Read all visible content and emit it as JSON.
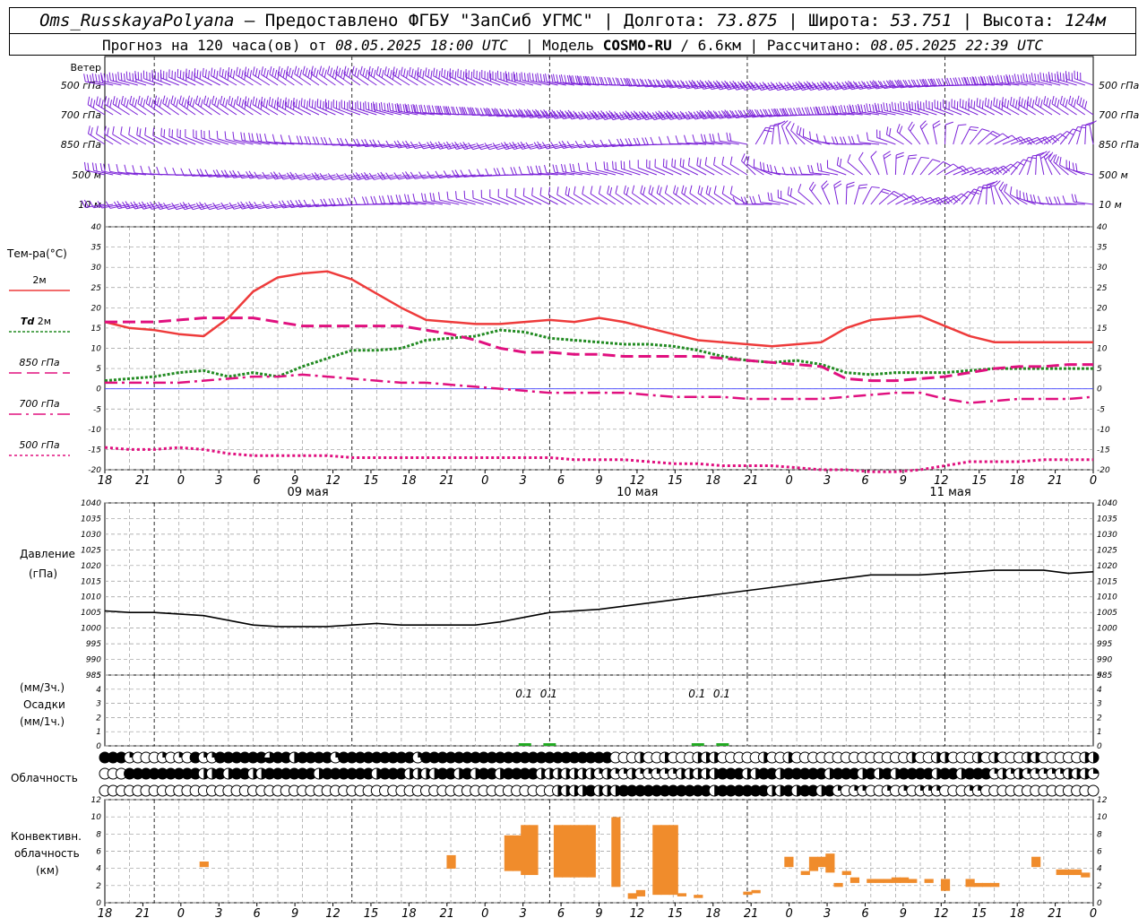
{
  "header": {
    "station": "Oms_RusskayaPolyana",
    "provided_label": "Предоставлено ФГБУ \"ЗапСиб УГМС\"",
    "lon_label": "Долгота:",
    "lon_value": "73.875",
    "lat_label": "Широта:",
    "lat_value": "53.751",
    "alt_label": "Высота:",
    "alt_value": "124м",
    "forecast_label": "Прогноз на 120 часа(ов) от",
    "forecast_time": "08.05.2025 18:00 UTC",
    "model_label": "Модель",
    "model_name": "COSMO-RU",
    "model_res": "/ 6.6км",
    "computed_label": "Рассчитано:",
    "computed_time": "08.05.2025 22:39 UTC"
  },
  "colors": {
    "wind": "#7b22d8",
    "t2m": "#ee3b3b",
    "td2m": "#228b22",
    "t850": "#e0107f",
    "t700": "#e0107f",
    "t500": "#e0107f",
    "pressure": "#000000",
    "precip": "#22aa22",
    "convective": "#f08c2c",
    "zero_line": "#4040ff"
  },
  "chart_data": [
    {
      "type": "wind_barbs",
      "panel_title": "Ветер",
      "levels": [
        "500 гПа",
        "700 гПа",
        "850 гПа",
        "500 м",
        "10 м"
      ],
      "x_hours": [
        0,
        120
      ],
      "note_speed_trend": "stronger winds at 500/700 гПа, mostly westerly; lighter variable winds near surface"
    },
    {
      "type": "line",
      "panel_title": "Тем-ра(°C)",
      "ylim": [
        -20,
        40
      ],
      "yticks": [
        -20,
        -15,
        -10,
        -5,
        0,
        5,
        10,
        15,
        20,
        25,
        30,
        35,
        40
      ],
      "x_tick_labels": [
        "18",
        "21",
        "0",
        "3",
        "6",
        "9",
        "12",
        "15",
        "18",
        "21",
        "0",
        "3",
        "6",
        "9",
        "12",
        "15",
        "18",
        "21",
        "0",
        "3",
        "6",
        "9",
        "12",
        "15",
        "18",
        "21",
        "0"
      ],
      "date_labels": [
        "09 мая",
        "10 мая",
        "11 мая"
      ],
      "x": [
        0,
        3,
        6,
        9,
        12,
        15,
        18,
        21,
        24,
        27,
        30,
        33,
        36,
        39,
        42,
        45,
        48,
        51,
        54,
        57,
        60,
        63,
        66,
        69,
        72,
        75,
        78,
        81,
        84,
        87,
        90,
        93,
        96,
        99,
        102,
        105,
        108,
        111,
        114,
        117,
        120
      ],
      "series": [
        {
          "name": "2м",
          "legend_key": "t2m",
          "values": [
            16.5,
            15.0,
            14.5,
            13.5,
            13.0,
            17.5,
            24.0,
            27.5,
            28.5,
            29.0,
            27.0,
            23.5,
            20.0,
            17.0,
            16.5,
            16.0,
            16.0,
            16.5,
            17.0,
            16.5,
            17.5,
            16.5,
            15.0,
            13.5,
            12.0,
            11.5,
            11.0,
            10.5,
            11.0,
            11.5,
            15.0,
            17.0,
            17.5,
            18.0,
            15.5,
            13.0,
            11.5,
            11.5,
            11.5,
            11.5,
            11.5
          ]
        },
        {
          "name": "Td 2м",
          "legend_key": "td2m",
          "values": [
            2.0,
            2.5,
            3.0,
            4.0,
            4.5,
            3.0,
            4.0,
            3.0,
            5.5,
            7.5,
            9.5,
            9.5,
            10.0,
            12.0,
            12.5,
            13.0,
            14.5,
            14.0,
            12.5,
            12.0,
            11.5,
            11.0,
            11.0,
            10.5,
            9.5,
            8.0,
            7.0,
            6.5,
            7.0,
            6.0,
            4.0,
            3.5,
            4.0,
            4.0,
            4.0,
            4.5,
            5.0,
            5.0,
            5.0,
            5.0,
            5.0
          ]
        },
        {
          "name": "850 гПа",
          "legend_key": "t850",
          "values": [
            16.5,
            16.5,
            16.5,
            17.0,
            17.5,
            17.5,
            17.5,
            16.5,
            15.5,
            15.5,
            15.5,
            15.5,
            15.5,
            14.5,
            13.5,
            12.0,
            10.0,
            9.0,
            9.0,
            8.5,
            8.5,
            8.0,
            8.0,
            8.0,
            8.0,
            7.5,
            7.0,
            6.5,
            6.0,
            5.5,
            2.5,
            2.0,
            2.0,
            2.5,
            3.0,
            4.0,
            5.0,
            5.5,
            5.5,
            6.0,
            6.0
          ]
        },
        {
          "name": "700 гПа",
          "legend_key": "t700",
          "values": [
            1.5,
            1.5,
            1.5,
            1.5,
            2.0,
            2.5,
            3.0,
            3.0,
            3.5,
            3.0,
            2.5,
            2.0,
            1.5,
            1.5,
            1.0,
            0.5,
            0.0,
            -0.5,
            -1.0,
            -1.0,
            -1.0,
            -1.0,
            -1.5,
            -2.0,
            -2.0,
            -2.0,
            -2.5,
            -2.5,
            -2.5,
            -2.5,
            -2.0,
            -1.5,
            -1.0,
            -1.0,
            -2.5,
            -3.5,
            -3.0,
            -2.5,
            -2.5,
            -2.5,
            -2.0
          ]
        },
        {
          "name": "500 гПа",
          "legend_key": "t500",
          "values": [
            -14.5,
            -15.0,
            -15.0,
            -14.5,
            -15.0,
            -16.0,
            -16.5,
            -16.5,
            -16.5,
            -16.5,
            -17.0,
            -17.0,
            -17.0,
            -17.0,
            -17.0,
            -17.0,
            -17.0,
            -17.0,
            -17.0,
            -17.5,
            -17.5,
            -17.5,
            -18.0,
            -18.5,
            -18.5,
            -19.0,
            -19.0,
            -19.0,
            -19.5,
            -20.0,
            -20.0,
            -20.5,
            -20.5,
            -20.0,
            -19.0,
            -18.0,
            -18.0,
            -18.0,
            -17.5,
            -17.5,
            -17.5
          ]
        }
      ]
    },
    {
      "type": "line",
      "panel_title": "Давление",
      "unit_label": "(гПа)",
      "ylim": [
        985,
        1040
      ],
      "yticks": [
        985,
        990,
        995,
        1000,
        1005,
        1010,
        1015,
        1020,
        1025,
        1030,
        1035,
        1040
      ],
      "x": [
        0,
        3,
        6,
        9,
        12,
        15,
        18,
        21,
        24,
        27,
        30,
        33,
        36,
        39,
        42,
        45,
        48,
        51,
        54,
        57,
        60,
        63,
        66,
        69,
        72,
        75,
        78,
        81,
        84,
        87,
        90,
        93,
        96,
        99,
        102,
        105,
        108,
        111,
        114,
        117,
        120
      ],
      "series": [
        {
          "name": "pressure",
          "values": [
            1005.5,
            1005.0,
            1005.0,
            1004.5,
            1004.0,
            1002.5,
            1001.0,
            1000.5,
            1000.5,
            1000.5,
            1001.0,
            1001.5,
            1001.0,
            1001.0,
            1001.0,
            1001.0,
            1002.0,
            1003.5,
            1005.0,
            1005.5,
            1006.0,
            1007.0,
            1008.0,
            1009.0,
            1010.0,
            1011.0,
            1012.0,
            1013.0,
            1014.0,
            1015.0,
            1016.0,
            1017.0,
            1017.0,
            1017.0,
            1017.5,
            1018.0,
            1018.5,
            1018.5,
            1018.5,
            1017.5,
            1018.0
          ]
        }
      ]
    },
    {
      "type": "bar",
      "panel_title": "Осадки",
      "unit_top": "(мм/3ч.)",
      "unit_bottom": "(мм/1ч.)",
      "ylim": [
        0,
        5
      ],
      "yticks": [
        0,
        1,
        2,
        3,
        4,
        5
      ],
      "bars": [
        {
          "h": 51,
          "value": 0.1
        },
        {
          "h": 54,
          "value": 0.1
        },
        {
          "h": 72,
          "value": 0.1
        },
        {
          "h": 75,
          "value": 0.1
        }
      ],
      "labels": [
        {
          "h": 51,
          "text": "0.1"
        },
        {
          "h": 54,
          "text": "0.1"
        },
        {
          "h": 72,
          "text": "0.1"
        },
        {
          "h": 75,
          "text": "0.1"
        }
      ]
    },
    {
      "type": "cloud_cover",
      "panel_title": "Облачность",
      "rows": 3,
      "row_meaning": [
        "high",
        "middle",
        "low"
      ],
      "step_hours": 1,
      "note": "octas symbols; full black = overcast"
    },
    {
      "type": "bar",
      "panel_title": "Конвективн. облачность (км)",
      "ylim": [
        0,
        13
      ],
      "yticks": [
        0,
        2,
        4,
        6,
        8,
        10,
        12
      ],
      "bars": [
        {
          "h": 12,
          "base": 4.5,
          "top": 5.2
        },
        {
          "h": 42,
          "base": 4.3,
          "top": 6.0
        },
        {
          "h": 49,
          "base": 4.0,
          "top": 8.5
        },
        {
          "h": 50,
          "base": 4.0,
          "top": 8.5
        },
        {
          "h": 51,
          "base": 3.5,
          "top": 9.8
        },
        {
          "h": 52,
          "base": 3.5,
          "top": 9.8
        },
        {
          "h": 55,
          "base": 3.2,
          "top": 9.8
        },
        {
          "h": 56,
          "base": 3.2,
          "top": 9.8
        },
        {
          "h": 57,
          "base": 3.2,
          "top": 9.8
        },
        {
          "h": 58,
          "base": 3.2,
          "top": 9.8
        },
        {
          "h": 59,
          "base": 3.2,
          "top": 9.8
        },
        {
          "h": 62,
          "base": 2.0,
          "top": 10.8
        },
        {
          "h": 64,
          "base": 0.5,
          "top": 1.2
        },
        {
          "h": 65,
          "base": 0.8,
          "top": 1.6
        },
        {
          "h": 67,
          "base": 1.0,
          "top": 9.8
        },
        {
          "h": 68,
          "base": 1.0,
          "top": 9.8
        },
        {
          "h": 69,
          "base": 1.0,
          "top": 9.8
        },
        {
          "h": 70,
          "base": 0.8,
          "top": 1.2
        },
        {
          "h": 72,
          "base": 0.6,
          "top": 1.0
        },
        {
          "h": 78,
          "base": 1.0,
          "top": 1.4
        },
        {
          "h": 79,
          "base": 1.2,
          "top": 1.6
        },
        {
          "h": 83,
          "base": 4.5,
          "top": 5.8
        },
        {
          "h": 85,
          "base": 3.5,
          "top": 4.0
        },
        {
          "h": 86,
          "base": 4.0,
          "top": 5.8
        },
        {
          "h": 87,
          "base": 4.5,
          "top": 5.8
        },
        {
          "h": 88,
          "base": 3.8,
          "top": 6.2
        },
        {
          "h": 89,
          "base": 2.0,
          "top": 2.5
        },
        {
          "h": 90,
          "base": 3.5,
          "top": 4.0
        },
        {
          "h": 91,
          "base": 2.5,
          "top": 3.2
        },
        {
          "h": 93,
          "base": 2.5,
          "top": 3.0
        },
        {
          "h": 94,
          "base": 2.5,
          "top": 3.0
        },
        {
          "h": 95,
          "base": 2.5,
          "top": 3.0
        },
        {
          "h": 96,
          "base": 2.5,
          "top": 3.2
        },
        {
          "h": 97,
          "base": 2.5,
          "top": 3.2
        },
        {
          "h": 98,
          "base": 2.5,
          "top": 3.0
        },
        {
          "h": 100,
          "base": 2.5,
          "top": 3.0
        },
        {
          "h": 102,
          "base": 1.5,
          "top": 3.0
        },
        {
          "h": 105,
          "base": 2.0,
          "top": 3.0
        },
        {
          "h": 106,
          "base": 2.0,
          "top": 2.5
        },
        {
          "h": 107,
          "base": 2.0,
          "top": 2.5
        },
        {
          "h": 108,
          "base": 2.0,
          "top": 2.5
        },
        {
          "h": 113,
          "base": 4.5,
          "top": 5.8
        },
        {
          "h": 116,
          "base": 3.5,
          "top": 4.2
        },
        {
          "h": 117,
          "base": 3.5,
          "top": 4.2
        },
        {
          "h": 118,
          "base": 3.5,
          "top": 4.2
        },
        {
          "h": 119,
          "base": 3.2,
          "top": 3.8
        }
      ]
    }
  ],
  "legend": {
    "temp_title": "Тем-ра(°C)",
    "t2m": "2м",
    "td_prefix": "Td",
    "td_suffix": "2м",
    "t850": "850 гПа",
    "t700": "700 гПа",
    "t500": "500 гПа",
    "pressure_title": "Давление",
    "pressure_unit": "(гПа)",
    "precip_unit_top": "(мм/3ч.)",
    "precip_title": "Осадки",
    "precip_unit_bottom": "(мм/1ч.)",
    "cloud_title": "Облачность",
    "conv_line1": "Конвективн.",
    "conv_line2": "облачность",
    "conv_line3": "(км)",
    "wind_title": "Ветер"
  }
}
